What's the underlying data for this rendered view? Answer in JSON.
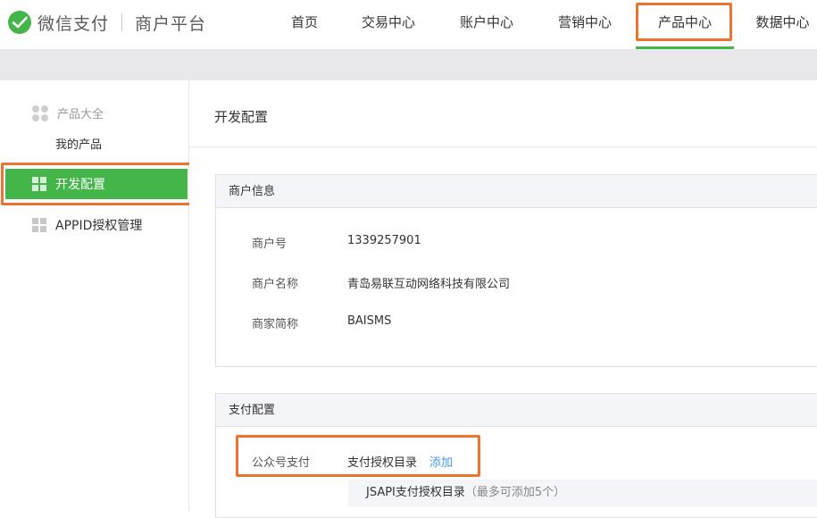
{
  "header": {
    "brand": "微信支付",
    "platform": "商户平台",
    "nav": [
      {
        "label": "首页"
      },
      {
        "label": "交易中心"
      },
      {
        "label": "账户中心"
      },
      {
        "label": "营销中心"
      },
      {
        "label": "产品中心",
        "active": true
      },
      {
        "label": "数据中心"
      }
    ]
  },
  "sidebar": {
    "group_label": "产品大全",
    "my_products": "我的产品",
    "items": [
      {
        "label": "开发配置",
        "active": true
      },
      {
        "label": "APPID授权管理"
      }
    ]
  },
  "main": {
    "title": "开发配置",
    "merchant_panel": {
      "heading": "商户信息",
      "rows": [
        {
          "label": "商户号",
          "value": "1339257901"
        },
        {
          "label": "商户名称",
          "value": "青岛易联互动网络科技有限公司"
        },
        {
          "label": "商家简称",
          "value": "BAISMS"
        }
      ]
    },
    "pay_panel": {
      "heading": "支付配置",
      "row_label": "公众号支付",
      "row_value": "支付授权目录",
      "add_link": "添加",
      "sub_title": "JSAPI支付授权目录",
      "sub_note": "（最多可添加5个）"
    }
  },
  "colors": {
    "accent_green": "#44b549",
    "highlight_orange": "#ee7230",
    "link_blue": "#459ae9"
  }
}
